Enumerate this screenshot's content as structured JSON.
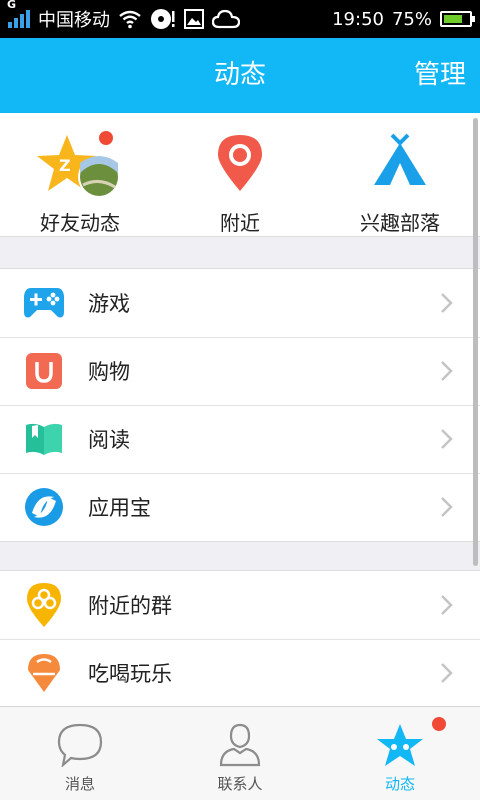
{
  "status_bar": {
    "network_type": "G",
    "carrier": "中国移动",
    "time": "19:50",
    "battery_level": "75%",
    "icons": [
      "signal-icon",
      "wifi-icon",
      "cd-icon",
      "image-icon",
      "cloud-icon",
      "battery-icon"
    ]
  },
  "title_bar": {
    "title": "动态",
    "action_label": "管理"
  },
  "quick_entries": [
    {
      "label": "好友动态",
      "icon": "qzone-star-icon",
      "has_badge": true
    },
    {
      "label": "附近",
      "icon": "location-pin-icon",
      "has_badge": false
    },
    {
      "label": "兴趣部落",
      "icon": "tent-icon",
      "has_badge": false
    }
  ],
  "group1": [
    {
      "label": "游戏",
      "icon": "gamepad-icon"
    },
    {
      "label": "购物",
      "icon": "shopping-bag-icon"
    },
    {
      "label": "阅读",
      "icon": "book-icon"
    },
    {
      "label": "应用宝",
      "icon": "app-store-icon"
    }
  ],
  "group2": [
    {
      "label": "附近的群",
      "icon": "nearby-group-icon"
    },
    {
      "label": "吃喝玩乐",
      "icon": "ice-cream-icon"
    }
  ],
  "tab_bar": [
    {
      "label": "消息",
      "icon": "chat-bubble-icon",
      "active": false
    },
    {
      "label": "联系人",
      "icon": "contact-person-icon",
      "active": false
    },
    {
      "label": "动态",
      "icon": "star-icon",
      "active": true,
      "has_badge": true
    }
  ],
  "colors": {
    "brand_blue": "#12b7f5",
    "badge_red": "#f04a36",
    "background": "#efeff4"
  }
}
